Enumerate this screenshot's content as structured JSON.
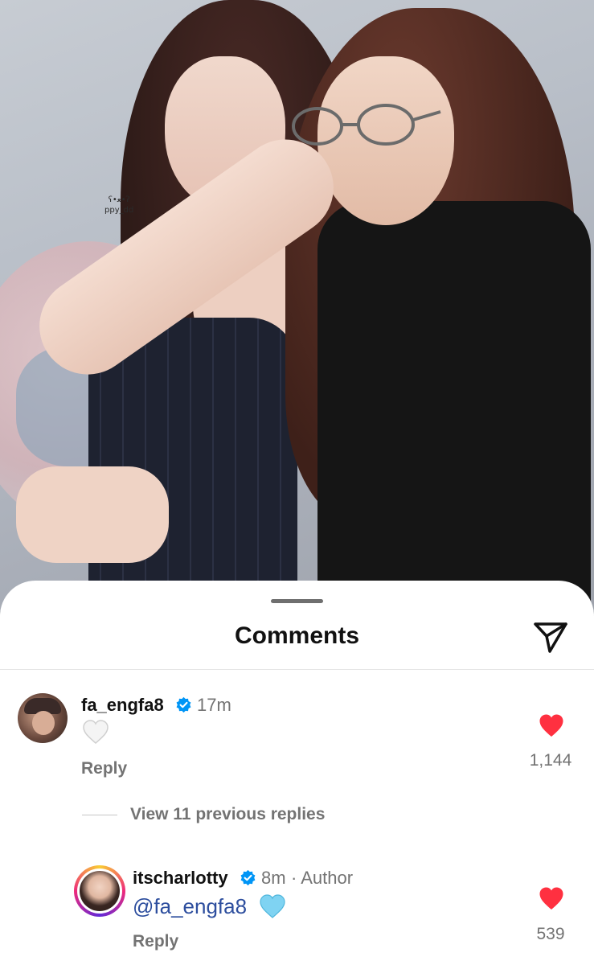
{
  "photo": {
    "watermark_line1": "ʕ•ﻌ•ʔ",
    "watermark_line2": "ppy_dd"
  },
  "sheet": {
    "title": "Comments"
  },
  "comments": [
    {
      "username": "fa_engfa8",
      "verified": true,
      "time": "17m",
      "text_emoji": "white-heart",
      "reply_label": "Reply",
      "likes": "1,144",
      "liked": true
    }
  ],
  "view_replies": "View 11 previous replies",
  "replies": [
    {
      "username": "itscharlotty",
      "verified": true,
      "time": "8m",
      "author_label": "· Author",
      "mention": "@fa_engfa8",
      "text_emoji": "light-blue-heart",
      "reply_label": "Reply",
      "likes": "539",
      "liked": true
    }
  ],
  "colors": {
    "like_red": "#ff3040",
    "verified_blue": "#0095f6",
    "mention_blue": "#2d4e9e",
    "light_blue_heart": "#7fd3f2"
  }
}
